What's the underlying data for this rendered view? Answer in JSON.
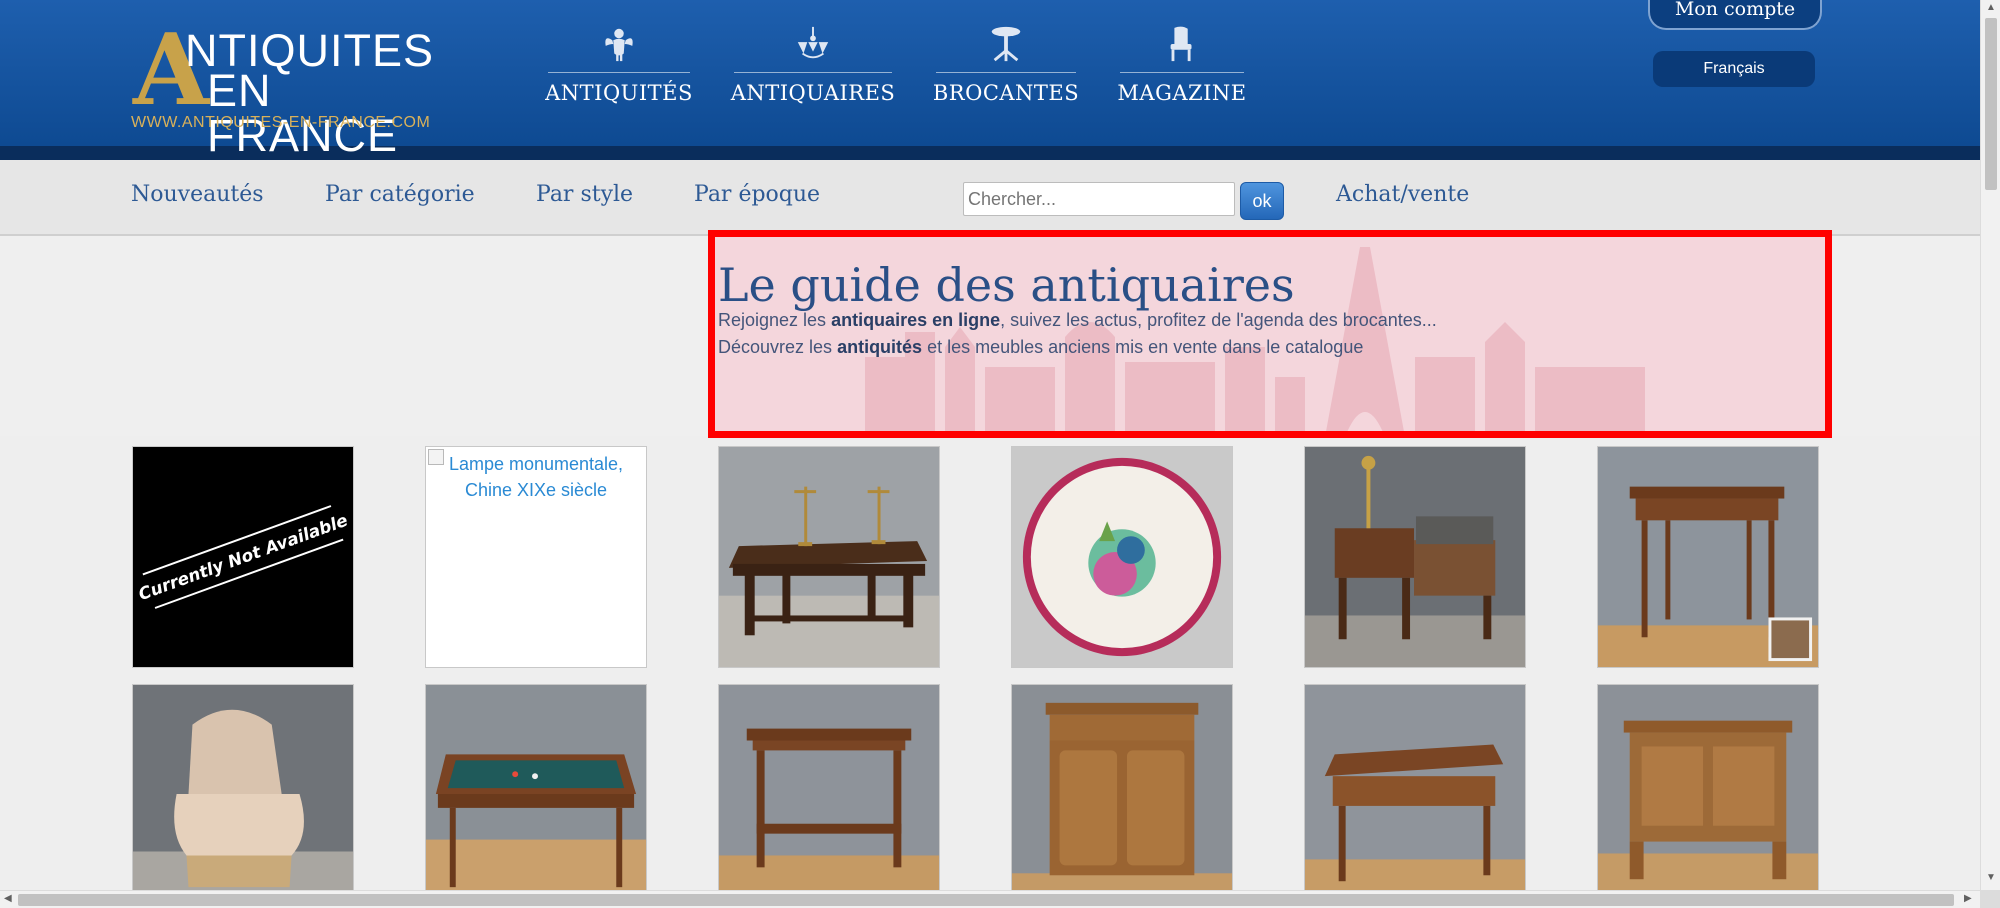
{
  "header": {
    "logo": {
      "letter": "A",
      "line1": "NTIQUITES",
      "line2": "EN FRANCE",
      "url": "WWW.ANTIQUITES-EN-FRANCE.COM"
    },
    "main_nav": [
      {
        "label": "ANTIQUITÉS",
        "icon": "cherub-icon"
      },
      {
        "label": "ANTIQUAIRES",
        "icon": "chandelier-icon"
      },
      {
        "label": "BROCANTES",
        "icon": "gueridon-table-icon"
      },
      {
        "label": "MAGAZINE",
        "icon": "armchair-icon"
      }
    ],
    "account_label": "Mon compte",
    "language_label": "Français"
  },
  "subnav": {
    "links": [
      "Nouveautés",
      "Par catégorie",
      "Par style",
      "Par époque"
    ],
    "search": {
      "placeholder": "Chercher...",
      "button_label": "ok"
    },
    "achat_label": "Achat/vente"
  },
  "hero": {
    "title": "Le guide des antiquaires",
    "line1": {
      "pre": "Rejoignez les ",
      "bold": "antiquaires en ligne",
      "post": ", suivez les actus, profitez de l'agenda des brocantes..."
    },
    "line2": {
      "pre": "Découvrez les ",
      "bold": "antiquités",
      "post": " et les meubles anciens mis en vente dans le catalogue"
    }
  },
  "products": [
    {
      "kind": "not-available",
      "text": "Currently Not Available"
    },
    {
      "kind": "broken",
      "alt": "Lampe monumentale, Chine XIXe siècle"
    },
    {
      "kind": "refectory-table-candelabra"
    },
    {
      "kind": "faience-plate"
    },
    {
      "kind": "writing-desk-telephone"
    },
    {
      "kind": "side-table"
    },
    {
      "kind": "bergere-armchair"
    },
    {
      "kind": "billiard-table"
    },
    {
      "kind": "serving-console"
    },
    {
      "kind": "buffet-cabinet"
    },
    {
      "kind": "writing-table"
    },
    {
      "kind": "chest-coffer"
    }
  ],
  "colors": {
    "header_blue": "#0e4a92",
    "logo_gold": "#c8a24a",
    "link_blue": "#2d5994",
    "highlight_border": "#ff0000"
  }
}
